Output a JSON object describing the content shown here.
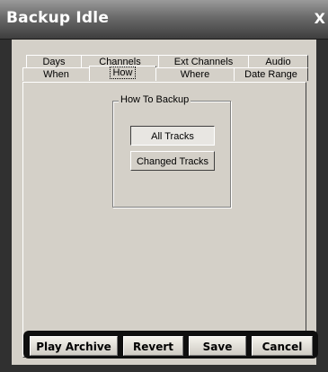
{
  "window": {
    "title": "Backup Idle",
    "close_label": "X"
  },
  "tabs": {
    "back_row": [
      "Days",
      "Channels",
      "Ext Channels",
      "Audio"
    ],
    "front_row": [
      "When",
      "How",
      "Where",
      "Date Range"
    ],
    "selected": "How"
  },
  "how_to_backup": {
    "legend": "How To Backup",
    "all_tracks_label": "All Tracks",
    "changed_tracks_label": "Changed Tracks"
  },
  "footer": {
    "play_archive_label": "Play Archive",
    "revert_label": "Revert",
    "save_label": "Save",
    "cancel_label": "Cancel"
  }
}
